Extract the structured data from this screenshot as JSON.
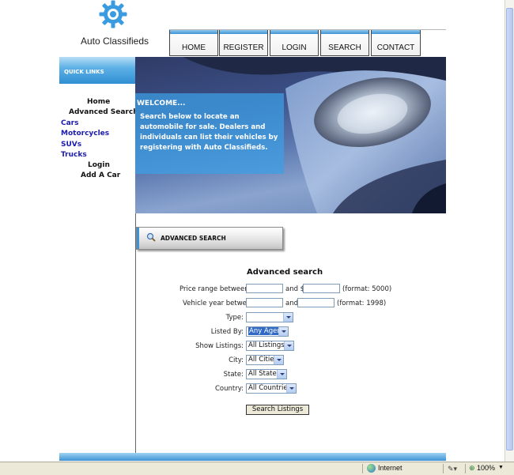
{
  "site": {
    "title": "Auto Classifieds"
  },
  "nav": {
    "items": [
      {
        "label": "HOME"
      },
      {
        "label": "REGISTER"
      },
      {
        "label": "LOGIN"
      },
      {
        "label": "SEARCH"
      },
      {
        "label": "CONTACT US"
      }
    ]
  },
  "sidebar": {
    "header": "QUICK LINKS",
    "links": [
      {
        "label": "Home"
      },
      {
        "label": "Advanced Search"
      },
      {
        "label": "Cars"
      },
      {
        "label": "Motorcycles"
      },
      {
        "label": "SUVs"
      },
      {
        "label": "Trucks"
      },
      {
        "label": "Login"
      },
      {
        "label": "Add A Car"
      }
    ]
  },
  "hero": {
    "title": "WELCOME...",
    "text": "Search below to locate an automobile for sale. Dealers and individuals can list their vehicles by registering with Auto Classifieds."
  },
  "adv_tab": {
    "label": "ADVANCED SEARCH"
  },
  "form": {
    "title": "Advanced search",
    "price_label": "Price range between $",
    "price_and": "and $",
    "price_format": "(format: 5000)",
    "year_label": "Vehicle year between",
    "year_and": "and",
    "year_format": "(format: 1998)",
    "type_label": "Type:",
    "type_value": "",
    "listed_by_label": "Listed By:",
    "listed_by_value": "Any Agent",
    "show_label": "Show Listings:",
    "show_value": "All Listings",
    "city_label": "City:",
    "city_value": "All Cities",
    "state_label": "State:",
    "state_value": "All States",
    "country_label": "Country:",
    "country_value": "All Countries",
    "submit_label": "Search Listings"
  },
  "statusbar": {
    "zone": "Internet",
    "zoom": "100%"
  },
  "colors": {
    "accent": "#3d93d4",
    "link_blue": "#1a1ab0"
  }
}
